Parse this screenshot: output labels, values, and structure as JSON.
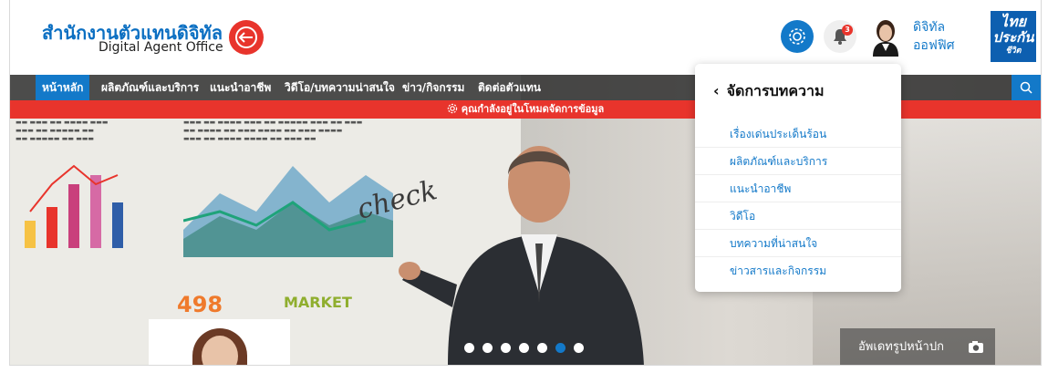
{
  "header": {
    "brand_th": "สำนักงานตัวแทนดิจิทัล",
    "brand_en": "Digital Agent Office",
    "notification_count": "3",
    "user_name_line1": "ดิจิทัล",
    "user_name_line2": "ออฟฟิศ",
    "partner_logo_line1": "ไทย",
    "partner_logo_line2": "ประกัน",
    "partner_logo_line3": "ชีวิต"
  },
  "nav": {
    "items": [
      {
        "label": "หน้าหลัก",
        "active": true
      },
      {
        "label": "ผลิตภัณฑ์และบริการ"
      },
      {
        "label": "แนะนำอาชีพ"
      },
      {
        "label": "วิดีโอ/บทความน่าสนใจ"
      },
      {
        "label": "ข่าว/กิจกรรม"
      },
      {
        "label": "ติดต่อตัวแทน"
      }
    ]
  },
  "alert": {
    "text": "คุณกำลังอยู่ในโหมดจัดการข้อมูล"
  },
  "hero": {
    "number_text": "498",
    "market_text": "MARKET",
    "check_text": "check",
    "slides": 7,
    "active_slide": 6,
    "cover_update_label": "อัพเดทรูปหน้าปก"
  },
  "dropdown": {
    "title": "จัดการบทความ",
    "items": [
      "เรื่องเด่นประเด็นร้อน",
      "ผลิตภัณฑ์และบริการ",
      "แนะนำอาชีพ",
      "วิดีโอ",
      "บทความที่น่าสนใจ",
      "ข่าวสารและกิจกรรม"
    ]
  },
  "colors": {
    "primary": "#1379c9",
    "accent_red": "#e8342c",
    "nav_bg": "#2d2d2d"
  }
}
